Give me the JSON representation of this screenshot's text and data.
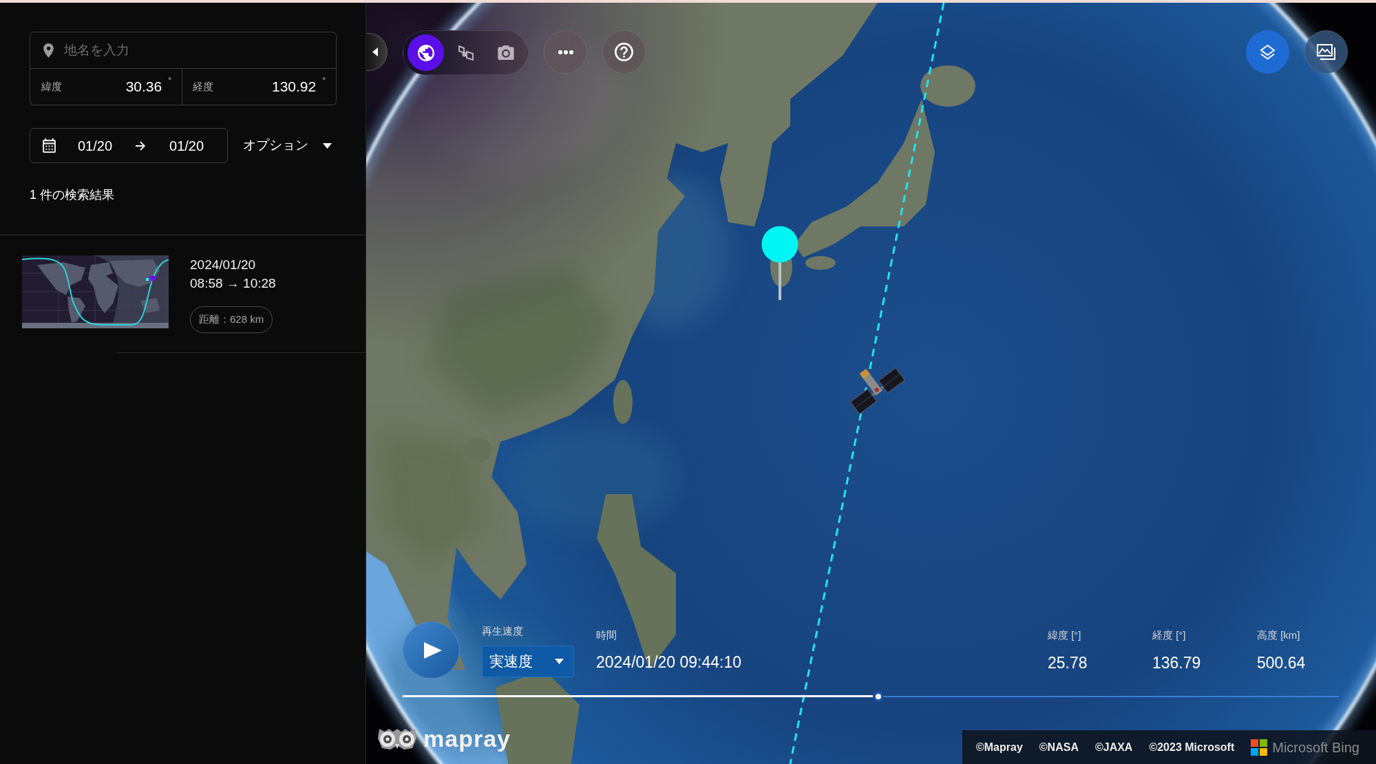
{
  "sidebar": {
    "place_search": {
      "placeholder": "地名を入力"
    },
    "coordinates": [
      {
        "label": "緯度",
        "value": "30.36",
        "unit": "°"
      },
      {
        "label": "経度",
        "value": "130.92",
        "unit": "°"
      }
    ],
    "date_range": {
      "start": "01/20",
      "end": "01/20"
    },
    "options_label": "オプション",
    "result_count": "1 件の検索結果",
    "results": [
      {
        "date": "2024/01/20",
        "time_range": "08:58 → 10:28",
        "distance": "距離：628 km"
      }
    ]
  },
  "map": {
    "view_buttons": [
      {
        "selected": true
      },
      {
        "selected": false
      },
      {
        "selected": false
      }
    ],
    "playback": {
      "speed_label": "再生速度",
      "speed_value": "実速度",
      "time_label": "時間",
      "time_value": "2024/01/20 09:44:10",
      "timeline": {
        "level": 0.508
      }
    },
    "telemetry": [
      {
        "label": "緯度 [°]",
        "value": "25.78"
      },
      {
        "label": "経度 [°]",
        "value": "136.79"
      },
      {
        "label": "高度 [km]",
        "value": "500.64"
      }
    ],
    "logo": "mapray",
    "attribution": {
      "credits": [
        "©Mapray",
        "©NASA",
        "©JAXA",
        "©2023 Microsoft"
      ],
      "provider": "Microsoft Bing"
    }
  }
}
